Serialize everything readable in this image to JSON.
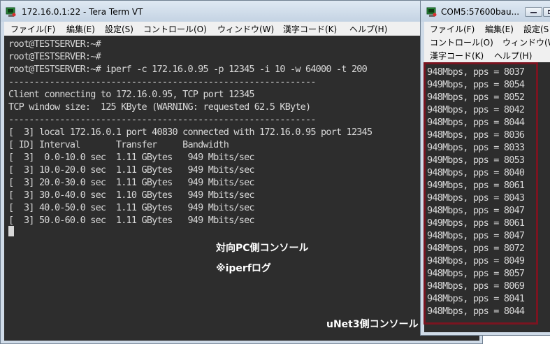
{
  "window1": {
    "title": "172.16.0.1:22 - Tera Term VT",
    "menu": [
      "ファイル(F)",
      "編集(E)",
      "設定(S)",
      "コントロール(O)",
      "ウィンドウ(W)",
      "漢字コード(K)",
      "ヘルプ(H)"
    ],
    "terminal_lines": [
      "root@TESTSERVER:~#",
      "root@TESTSERVER:~#",
      "root@TESTSERVER:~# iperf -c 172.16.0.95 -p 12345 -i 10 -w 64000 -t 200",
      "------------------------------------------------------------",
      "Client connecting to 172.16.0.95, TCP port 12345",
      "TCP window size:  125 KByte (WARNING: requested 62.5 KByte)",
      "------------------------------------------------------------",
      "[  3] local 172.16.0.1 port 40830 connected with 172.16.0.95 port 12345",
      "[ ID] Interval       Transfer     Bandwidth",
      "[  3]  0.0-10.0 sec  1.11 GBytes   949 Mbits/sec",
      "[  3] 10.0-20.0 sec  1.11 GBytes   949 Mbits/sec",
      "[  3] 20.0-30.0 sec  1.11 GBytes   949 Mbits/sec",
      "[  3] 30.0-40.0 sec  1.10 GBytes   949 Mbits/sec",
      "[  3] 40.0-50.0 sec  1.11 GBytes   949 Mbits/sec",
      "[  3] 50.0-60.0 sec  1.11 GBytes   949 Mbits/sec"
    ],
    "note_console": "対向PC側コンソール",
    "note_log": "※iperfログ"
  },
  "window2": {
    "title": "COM5:57600bau...",
    "menu_row1": [
      "ファイル(F)",
      "編集(E)",
      "設定(S"
    ],
    "menu_row2": [
      "コントロール(O)",
      "ウィンドウ(W"
    ],
    "menu_row3": [
      "漢字コード(K)",
      "ヘルプ(H)"
    ],
    "pps_lines": [
      "948Mbps, pps = 8037",
      "949Mbps, pps = 8054",
      "948Mbps, pps = 8052",
      "948Mbps, pps = 8042",
      "948Mbps, pps = 8044",
      "948Mbps, pps = 8036",
      "949Mbps, pps = 8033",
      "949Mbps, pps = 8053",
      "948Mbps, pps = 8040",
      "949Mbps, pps = 8061",
      "948Mbps, pps = 8043",
      "948Mbps, pps = 8047",
      "949Mbps, pps = 8061",
      "948Mbps, pps = 8047",
      "948Mbps, pps = 8072",
      "948Mbps, pps = 8049",
      "948Mbps, pps = 8057",
      "948Mbps, pps = 8069",
      "948Mbps, pps = 8041",
      "948Mbps, pps = 8044"
    ],
    "note_console": "uNet3側コンソール",
    "highlight_color": "#7a1420"
  }
}
